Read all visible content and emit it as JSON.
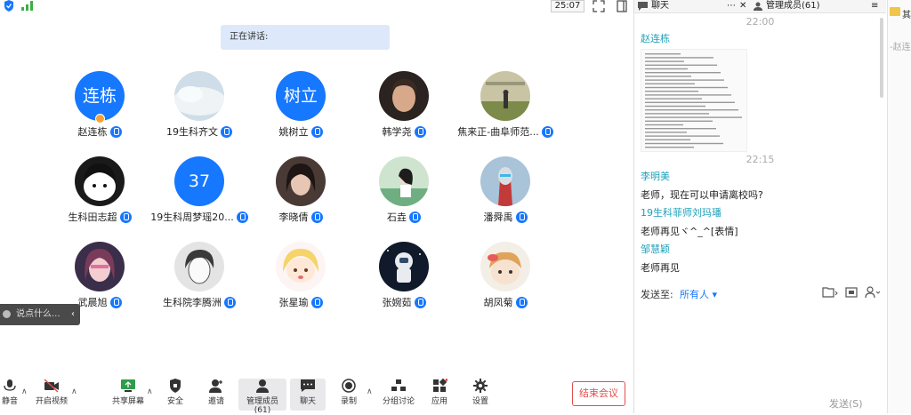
{
  "topbar": {
    "timer": "25:07"
  },
  "speaking": {
    "label": "正在讲话:"
  },
  "participants": [
    {
      "name": "赵连栋",
      "avatar_text": "连栋",
      "type": "text",
      "host": true
    },
    {
      "name": "19生科齐文",
      "avatar_text": "",
      "type": "sky"
    },
    {
      "name": "姚树立",
      "avatar_text": "树立",
      "type": "text"
    },
    {
      "name": "韩学尧",
      "avatar_text": "",
      "type": "photo-boy"
    },
    {
      "name": "焦来正-曲阜师范...",
      "avatar_text": "",
      "type": "photo-field"
    },
    {
      "name": "生科田志超",
      "avatar_text": "",
      "type": "cartoon-bw"
    },
    {
      "name": "19生科周梦瑶20...",
      "avatar_text": "37",
      "type": "text"
    },
    {
      "name": "李晓倩",
      "avatar_text": "",
      "type": "girl-dark"
    },
    {
      "name": "石垚",
      "avatar_text": "",
      "type": "girl-green"
    },
    {
      "name": "潘舜禹",
      "avatar_text": "",
      "type": "robot"
    },
    {
      "name": "武晨旭",
      "avatar_text": "",
      "type": "girl-pink"
    },
    {
      "name": "生科院李腾洲",
      "avatar_text": "",
      "type": "sketch"
    },
    {
      "name": "张星瑜",
      "avatar_text": "",
      "type": "cartoon-yellow"
    },
    {
      "name": "张婉茹",
      "avatar_text": "",
      "type": "astronaut"
    },
    {
      "name": "胡凤菊",
      "avatar_text": "",
      "type": "cartoon-plush"
    }
  ],
  "say_input": {
    "placeholder": "说点什么...",
    "collapse": "‹"
  },
  "toolbar": {
    "mute": "静音",
    "video": "开启视频",
    "share": "共享屏幕",
    "security": "安全",
    "invite": "邀请",
    "members": "管理成员(61)",
    "chat": "聊天",
    "record": "录制",
    "breakout": "分组讨论",
    "apps": "应用",
    "settings": "设置",
    "end": "结束会议"
  },
  "chat": {
    "tab_chat": "聊天",
    "tab_members": "管理成员(61)",
    "messages": [
      {
        "kind": "time",
        "text": "22:00"
      },
      {
        "kind": "sender",
        "text": "赵连栋"
      },
      {
        "kind": "image",
        "text": ""
      },
      {
        "kind": "time",
        "text": "22:15"
      },
      {
        "kind": "sender",
        "text": "李明美"
      },
      {
        "kind": "msg",
        "text": "老师，现在可以申请离校吗?"
      },
      {
        "kind": "sender",
        "text": "19生科菲师刘玛璠"
      },
      {
        "kind": "msg",
        "text": "老师再见ヾ^_^[表情]"
      },
      {
        "kind": "sender",
        "text": "邹慧颖"
      },
      {
        "kind": "msg",
        "text": "老师再见"
      }
    ],
    "send_to_label": "发送至:",
    "send_to_value": "所有人 ▾",
    "send_button": "发送(S)"
  },
  "far_right": {
    "title": "其",
    "snippet": "-赵连"
  }
}
